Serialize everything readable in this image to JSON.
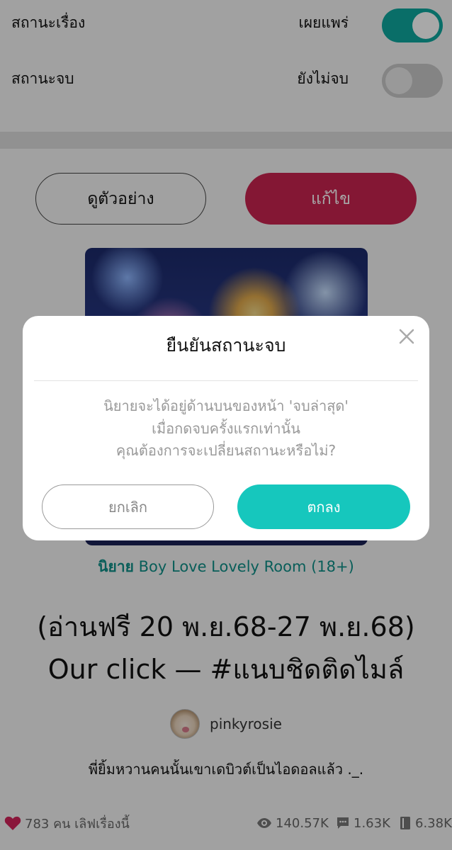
{
  "settings": {
    "story_status": {
      "label": "สถานะเรื่อง",
      "value": "เผยแพร่",
      "toggle_on": true
    },
    "end_status": {
      "label": "สถานะจบ",
      "value": "ยังไม่จบ",
      "toggle_on": false
    }
  },
  "actions": {
    "preview_label": "ดูตัวอย่าง",
    "edit_label": "แก้ไข"
  },
  "story": {
    "genre_prefix": "นิยาย",
    "genre_name": "Boy Love Lovely Room (18+)",
    "title_line1": "(อ่านฟรี 20 พ.ย.68-27 พ.ย.68)",
    "title_line2": "Our click — #แนบชิดติดไมล์",
    "author": "pinkyrosie",
    "subtitle": "พี่ยิ้มหวานคนนั้นเขาเดบิวต์เป็นไอดอลแล้ว ._."
  },
  "stats": {
    "likes": "783 คน เลิฟเรื่องนี้",
    "views": "140.57K",
    "comments": "1.63K",
    "chapters": "6.38K"
  },
  "modal": {
    "title": "ยืนยันสถานะจบ",
    "message_line1": "นิยายจะได้อยู่ด้านบนของหน้า 'จบล่าสุด'",
    "message_line2": "เมื่อกดจบครั้งแรกเท่านั้น",
    "message_line3": "คุณต้องการจะเปลี่ยนสถานะหรือไม่?",
    "cancel_label": "ยกเลิก",
    "ok_label": "ตกลง"
  },
  "colors": {
    "accent_teal": "#16c7bd",
    "edit_button": "#c8244f",
    "genre_text": "#0f8f88",
    "heart": "#d2245a"
  },
  "icons": [
    "heart-icon",
    "eye-icon",
    "comment-icon",
    "book-icon",
    "close-icon"
  ]
}
